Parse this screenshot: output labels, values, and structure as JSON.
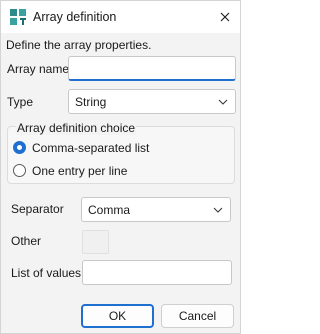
{
  "window": {
    "title": "Array definition",
    "icon": "array-app-icon",
    "close_icon": "close-icon"
  },
  "intro": "Define the array properties.",
  "array_name": {
    "label": "Array name",
    "value": ""
  },
  "type": {
    "label": "Type",
    "selected": "String"
  },
  "choice": {
    "group_label": "Array definition choice",
    "options": [
      {
        "label": "Comma-separated list",
        "checked": true
      },
      {
        "label": "One entry per line",
        "checked": false
      }
    ]
  },
  "separator": {
    "label": "Separator",
    "selected": "Comma"
  },
  "other": {
    "label": "Other",
    "value": ""
  },
  "list_of_values": {
    "label": "List of values",
    "value": ""
  },
  "buttons": {
    "ok": "OK",
    "cancel": "Cancel"
  },
  "colors": {
    "accent": "#1f6fd1",
    "background": "#f3f3f3",
    "icon_teal": "#2e8b8b"
  }
}
